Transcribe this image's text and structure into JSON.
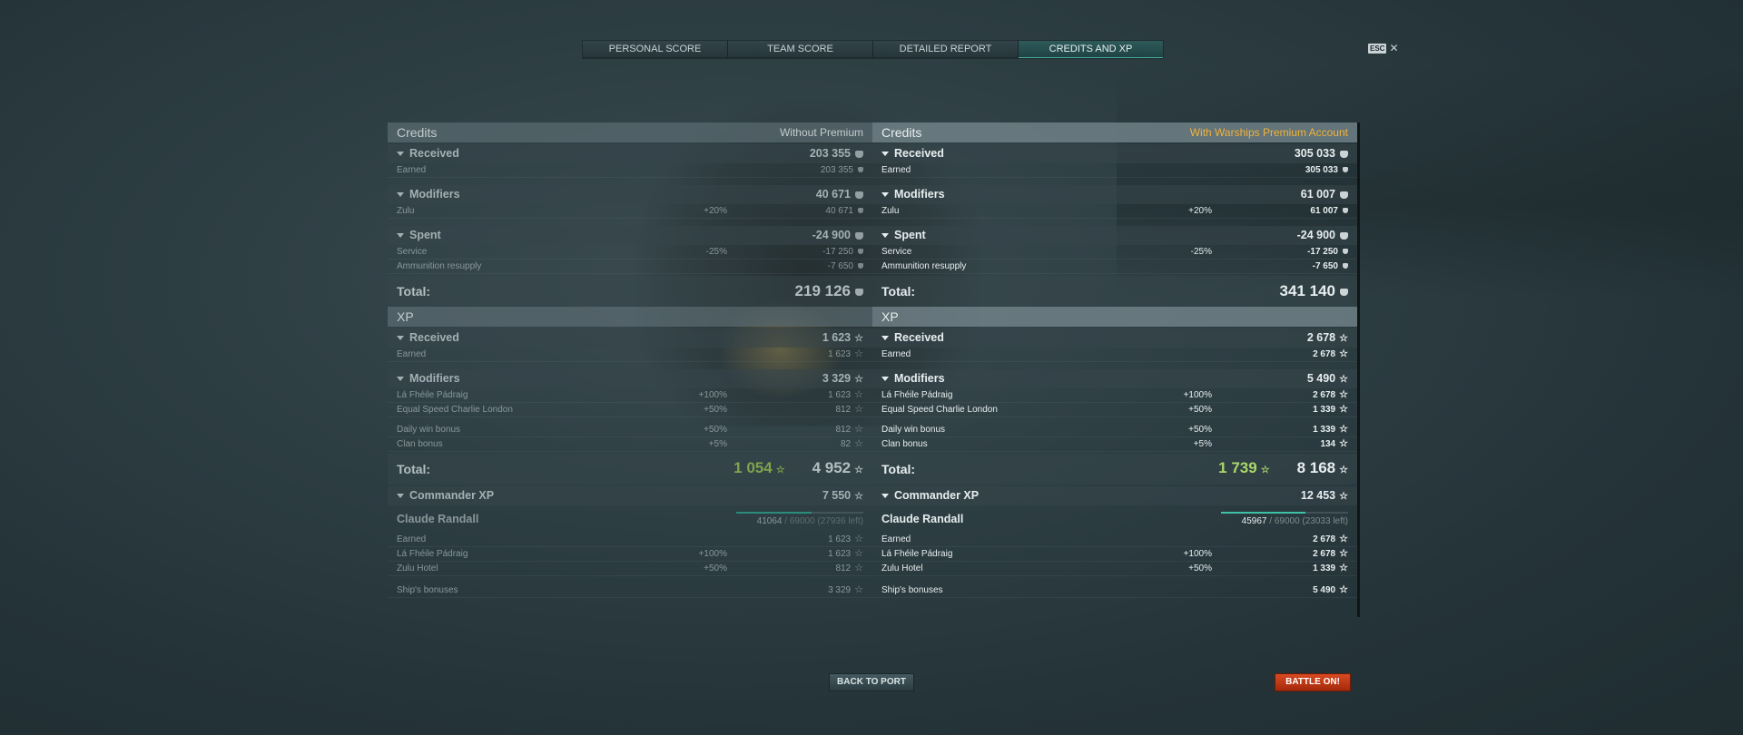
{
  "tabs": [
    {
      "label": "PERSONAL SCORE"
    },
    {
      "label": "TEAM SCORE"
    },
    {
      "label": "DETAILED REPORT"
    },
    {
      "label": "CREDITS AND XP"
    }
  ],
  "esc": {
    "key": "ESC",
    "close": "✕"
  },
  "left": {
    "credits_title": "Credits",
    "credits_variant": "Without Premium",
    "received": {
      "label": "Received",
      "value": "203 355"
    },
    "earned": {
      "label": "Earned",
      "value": "203 355"
    },
    "modifiers": {
      "label": "Modifiers",
      "value": "40 671"
    },
    "zulu": {
      "label": "Zulu",
      "pct": "+20%",
      "value": "40 671"
    },
    "spent": {
      "label": "Spent",
      "value": "-24 900"
    },
    "service": {
      "label": "Service",
      "pct": "-25%",
      "value": "-17 250"
    },
    "ammo": {
      "label": "Ammunition resupply",
      "value": "-7 650"
    },
    "credits_total": {
      "label": "Total:",
      "value": "219 126"
    },
    "xp_title": "XP",
    "xp_received": {
      "label": "Received",
      "value": "1 623"
    },
    "xp_earned": {
      "label": "Earned",
      "value": "1 623"
    },
    "xp_modifiers": {
      "label": "Modifiers",
      "value": "3 329"
    },
    "fheile": {
      "label": "Lá Fhéile Pádraig",
      "pct": "+100%",
      "value": "1 623"
    },
    "speed": {
      "label": "Equal Speed Charlie London",
      "pct": "+50%",
      "value": "812"
    },
    "daily": {
      "label": "Daily win bonus",
      "pct": "+50%",
      "value": "812"
    },
    "clan": {
      "label": "Clan bonus",
      "pct": "+5%",
      "value": "82"
    },
    "xp_total": {
      "label": "Total:",
      "free": "1 054",
      "value": "4 952"
    },
    "cmdr_xp": {
      "label": "Commander XP",
      "value": "7 550"
    },
    "commander": {
      "name": "Claude Randall",
      "current": "41064",
      "rest": " / 69000 (27936 left)",
      "progress": 0.595
    },
    "c_earned": {
      "label": "Earned",
      "value": "1 623"
    },
    "c_fheile": {
      "label": "Lá Fhéile Pádraig",
      "pct": "+100%",
      "value": "1 623"
    },
    "c_zulu": {
      "label": "Zulu Hotel",
      "pct": "+50%",
      "value": "812"
    },
    "c_ship": {
      "label": "Ship's bonuses",
      "value": "3 329"
    }
  },
  "right": {
    "credits_title": "Credits",
    "credits_variant": "With Warships Premium Account",
    "received": {
      "label": "Received",
      "value": "305 033"
    },
    "earned": {
      "label": "Earned",
      "value": "305 033"
    },
    "modifiers": {
      "label": "Modifiers",
      "value": "61 007"
    },
    "zulu": {
      "label": "Zulu",
      "pct": "+20%",
      "value": "61 007"
    },
    "spent": {
      "label": "Spent",
      "value": "-24 900"
    },
    "service": {
      "label": "Service",
      "pct": "-25%",
      "value": "-17 250"
    },
    "ammo": {
      "label": "Ammunition resupply",
      "value": "-7 650"
    },
    "credits_total": {
      "label": "Total:",
      "value": "341 140"
    },
    "xp_title": "XP",
    "xp_received": {
      "label": "Received",
      "value": "2 678"
    },
    "xp_earned": {
      "label": "Earned",
      "value": "2 678"
    },
    "xp_modifiers": {
      "label": "Modifiers",
      "value": "5 490"
    },
    "fheile": {
      "label": "Lá Fhéile Pádraig",
      "pct": "+100%",
      "value": "2 678"
    },
    "speed": {
      "label": "Equal Speed Charlie London",
      "pct": "+50%",
      "value": "1 339"
    },
    "daily": {
      "label": "Daily win bonus",
      "pct": "+50%",
      "value": "1 339"
    },
    "clan": {
      "label": "Clan bonus",
      "pct": "+5%",
      "value": "134"
    },
    "xp_total": {
      "label": "Total:",
      "free": "1 739",
      "value": "8 168"
    },
    "cmdr_xp": {
      "label": "Commander XP",
      "value": "12 453"
    },
    "commander": {
      "name": "Claude Randall",
      "current": "45967",
      "rest": " / 69000 (23033 left)",
      "progress": 0.666
    },
    "c_earned": {
      "label": "Earned",
      "value": "2 678"
    },
    "c_fheile": {
      "label": "Lá Fhéile Pádraig",
      "pct": "+100%",
      "value": "2 678"
    },
    "c_zulu": {
      "label": "Zulu Hotel",
      "pct": "+50%",
      "value": "1 339"
    },
    "c_ship": {
      "label": "Ship's bonuses",
      "value": "5 490"
    }
  },
  "buttons": {
    "back": "BACK TO PORT",
    "battle": "BATTLE ON!"
  },
  "icons": {
    "credit": "credit-coin-icon",
    "xp": "star-icon",
    "dropdown": "triangle-down-icon",
    "close": "close-icon"
  },
  "colors": {
    "premium": "#f0b33a",
    "free_xp": "#a9d86a",
    "progress": "#3fc1a7",
    "battle": "#c63a16"
  }
}
